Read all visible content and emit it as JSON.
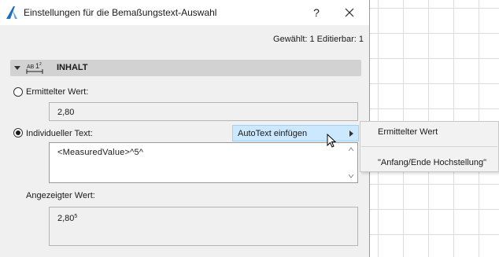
{
  "window": {
    "title": "Einstellungen für die Bemaßungstext-Auswahl",
    "help_label": "?"
  },
  "status": {
    "selected_info": "Gewählt: 1 Editierbar: 1"
  },
  "section": {
    "label": "INHALT",
    "icon_text": "AB·1²"
  },
  "options": {
    "measured_label": "Ermittelter Wert:",
    "measured_value": "2,80",
    "custom_label": "Individueller Text:",
    "custom_text": "<MeasuredValue>^5^",
    "measured_checked": false,
    "custom_checked": true
  },
  "display": {
    "label": "Angezeigter Wert:",
    "value_main": "2,80",
    "value_sup": "5"
  },
  "context_menu": {
    "autotext_label": "AutoText einfügen"
  },
  "submenu": {
    "items": [
      "Ermittelter Wert",
      "\"Anfang/Ende Hochstellung\""
    ]
  }
}
